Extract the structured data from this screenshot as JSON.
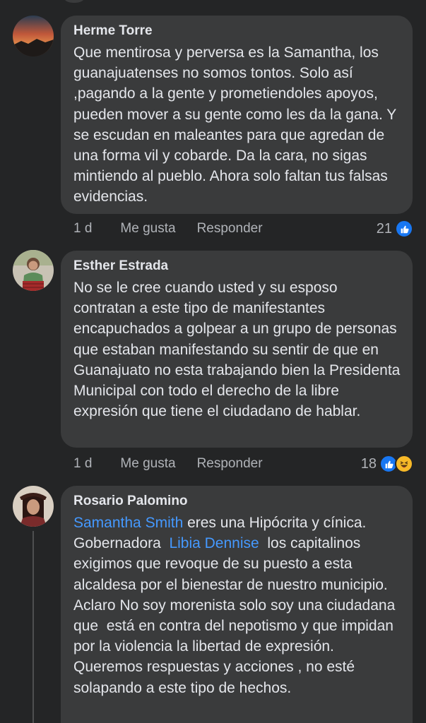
{
  "comments": [
    {
      "author": "Herme Torre",
      "text": "Que mentirosa y perversa es la Samantha, los guanajuatenses no somos tontos. Solo así ,pagando a la gente y prometiendoles apoyos, pueden mover a su gente como les da la gana.  Y se escudan en maleantes para que agredan de una forma vil y cobarde. Da la cara, no sigas mintiendo al pueblo. Ahora solo faltan tus falsas evidencias.",
      "time": "1 d",
      "like_label": "Me gusta",
      "reply_label": "Responder",
      "reactions": "21"
    },
    {
      "author": "Esther Estrada",
      "text": "No se le cree cuando usted y su esposo contratan a este tipo de manifestantes encapuchados a golpear a un grupo de personas que estaban manifestando su sentir de que en Guanajuato no esta trabajando bien la Presidenta Municipal con todo el derecho de la libre expresión que tiene el ciudadano de hablar.",
      "time": "1 d",
      "like_label": "Me gusta",
      "reply_label": "Responder",
      "reactions": "18"
    },
    {
      "author": "Rosario Palomino",
      "mention1": "Samantha Smith",
      "text1": " eres una Hipócrita y cínica. Gobernadora  ",
      "mention2": "Libia Dennise",
      "text2": "  los capitalinos exigimos que revoque de su puesto a esta alcaldesa por el bienestar de nuestro municipio. Aclaro No soy morenista solo soy una ciudadana que  está en contra del nepotismo y que impidan por la violencia la libertad de expresión. Queremos respuestas y acciones , no esté solapando a este tipo de hechos."
    }
  ],
  "colors": {
    "background": "#242526",
    "bubble": "#3a3b3c",
    "text": "#e4e6eb",
    "secondary": "#b0b3b8",
    "mention": "#4599ff",
    "like": "#1877f2",
    "haha": "#f7b928"
  },
  "icons": [
    "like-reaction-icon",
    "haha-reaction-icon"
  ]
}
